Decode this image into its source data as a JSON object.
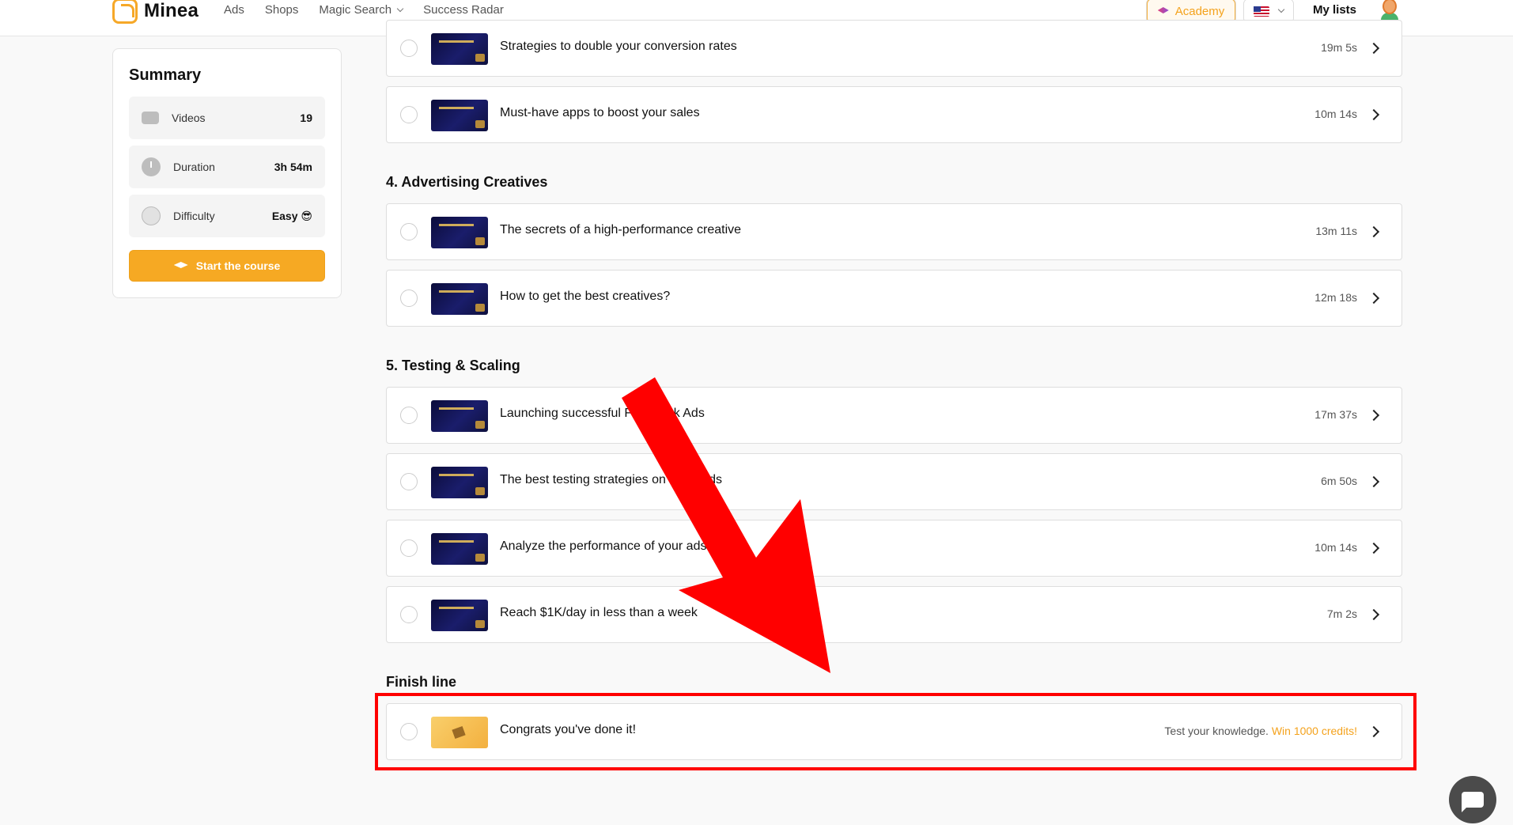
{
  "header": {
    "brand": "Minea",
    "nav": [
      {
        "label": "Ads"
      },
      {
        "label": "Shops"
      },
      {
        "label": "Magic Search"
      },
      {
        "label": "Success Radar"
      }
    ],
    "academy_label": "Academy",
    "my_lists_label": "My lists"
  },
  "summary": {
    "title": "Summary",
    "rows": [
      {
        "label": "Videos",
        "value": "19"
      },
      {
        "label": "Duration",
        "value": "3h 54m"
      },
      {
        "label": "Difficulty",
        "value": "Easy 😎"
      }
    ],
    "start_label": "Start the course"
  },
  "lessons_top": [
    {
      "title": "Strategies to double your conversion rates",
      "duration": "19m 5s"
    },
    {
      "title": "Must-have apps to boost your sales",
      "duration": "10m 14s"
    }
  ],
  "section4": {
    "heading": "4. Advertising Creatives",
    "lessons": [
      {
        "title": "The secrets of a high-performance creative",
        "duration": "13m 11s"
      },
      {
        "title": "How to get the best creatives?",
        "duration": "12m 18s"
      }
    ]
  },
  "section5": {
    "heading": "5. Testing & Scaling",
    "lessons": [
      {
        "title": "Launching successful Facebook Ads",
        "duration": "17m 37s"
      },
      {
        "title": "The best testing strategies on Meta Ads",
        "duration": "6m 50s"
      },
      {
        "title": "Analyze the performance of your ads",
        "duration": "10m 14s"
      },
      {
        "title": "Reach $1K/day in less than a week",
        "duration": "7m 2s"
      }
    ]
  },
  "finish": {
    "heading": "Finish line",
    "title": "Congrats you've done it!",
    "note": "Test your knowledge.",
    "reward": "Win 1000 credits!"
  },
  "colors": {
    "accent": "#f6a923",
    "annotation": "#ff0000"
  }
}
